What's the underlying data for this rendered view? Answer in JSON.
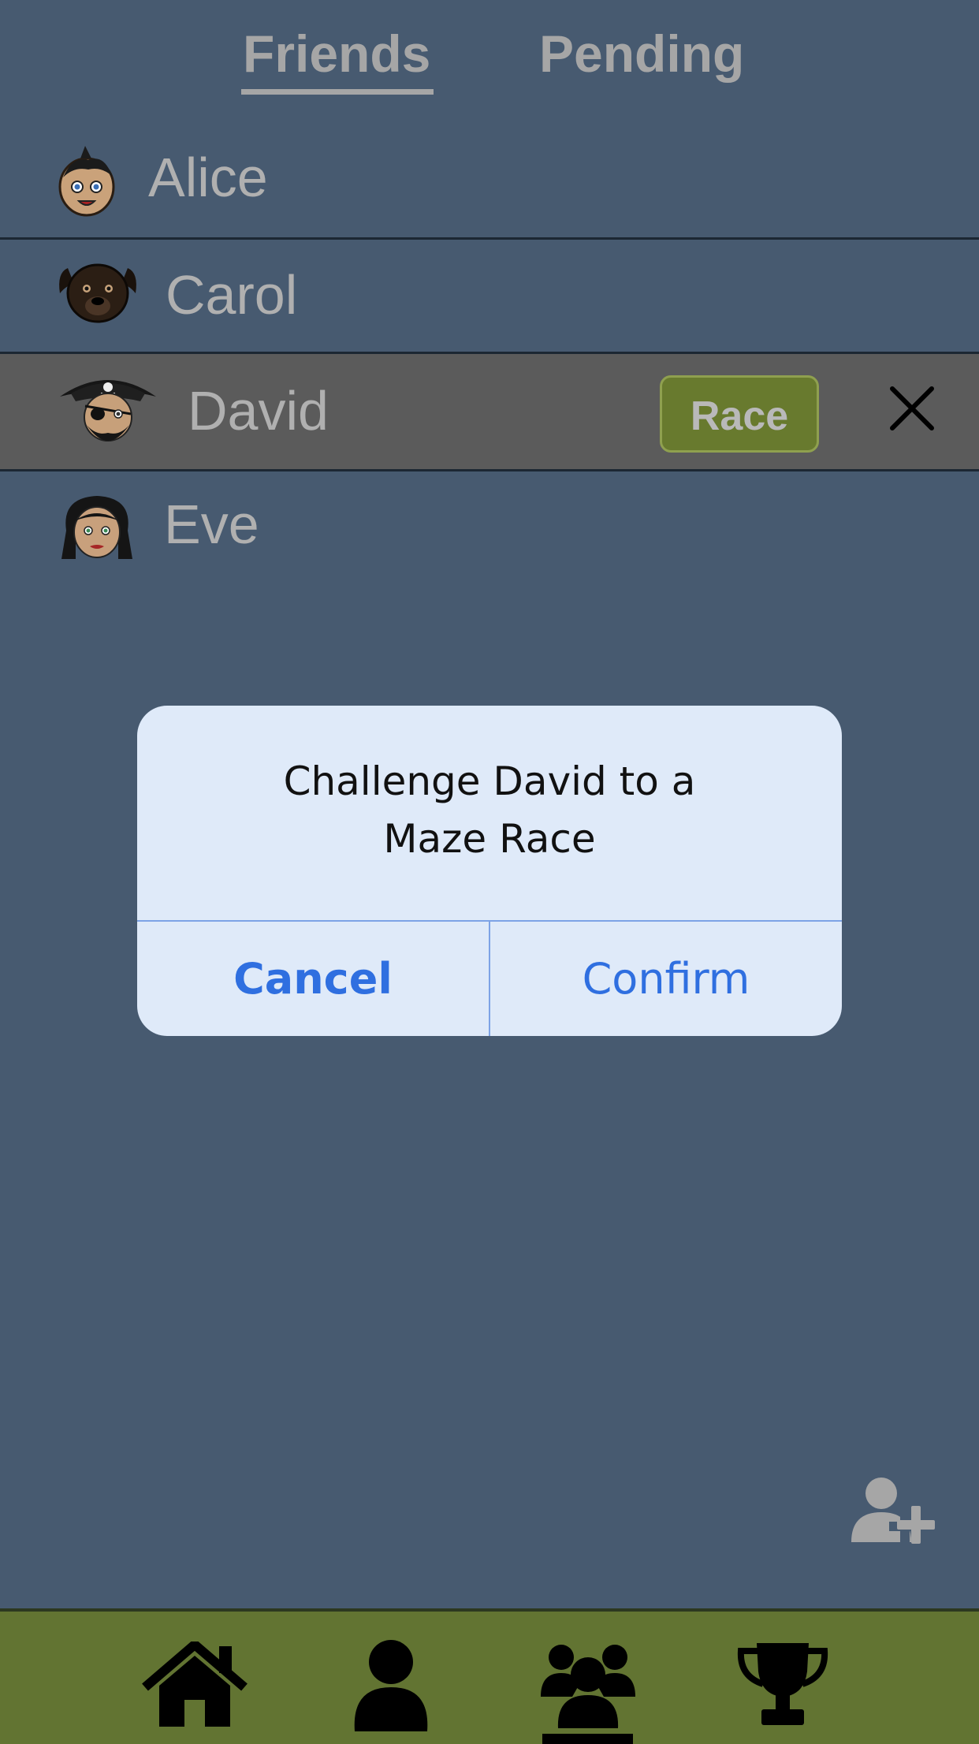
{
  "tabs": {
    "friends": "Friends",
    "pending": "Pending"
  },
  "friends": [
    {
      "name": "Alice",
      "avatar": "boy-avatar-icon"
    },
    {
      "name": "Carol",
      "avatar": "dog-avatar-icon"
    },
    {
      "name": "David",
      "avatar": "pirate-avatar-icon",
      "selected": true
    },
    {
      "name": "Eve",
      "avatar": "girl-avatar-icon"
    }
  ],
  "selected_row": {
    "race_label": "Race"
  },
  "dialog": {
    "title_line1": "Challenge David to a",
    "title_line2": "Maze Race",
    "cancel_label": "Cancel",
    "confirm_label": "Confirm"
  },
  "nav": [
    "home-icon",
    "profile-icon",
    "friends-icon",
    "trophy-icon"
  ],
  "colors": {
    "background": "#475a70",
    "nav_bar": "#627432",
    "race_button": "#687a2e",
    "dialog_bg": "#dfeaf9",
    "dialog_button": "#2f6fe0"
  }
}
